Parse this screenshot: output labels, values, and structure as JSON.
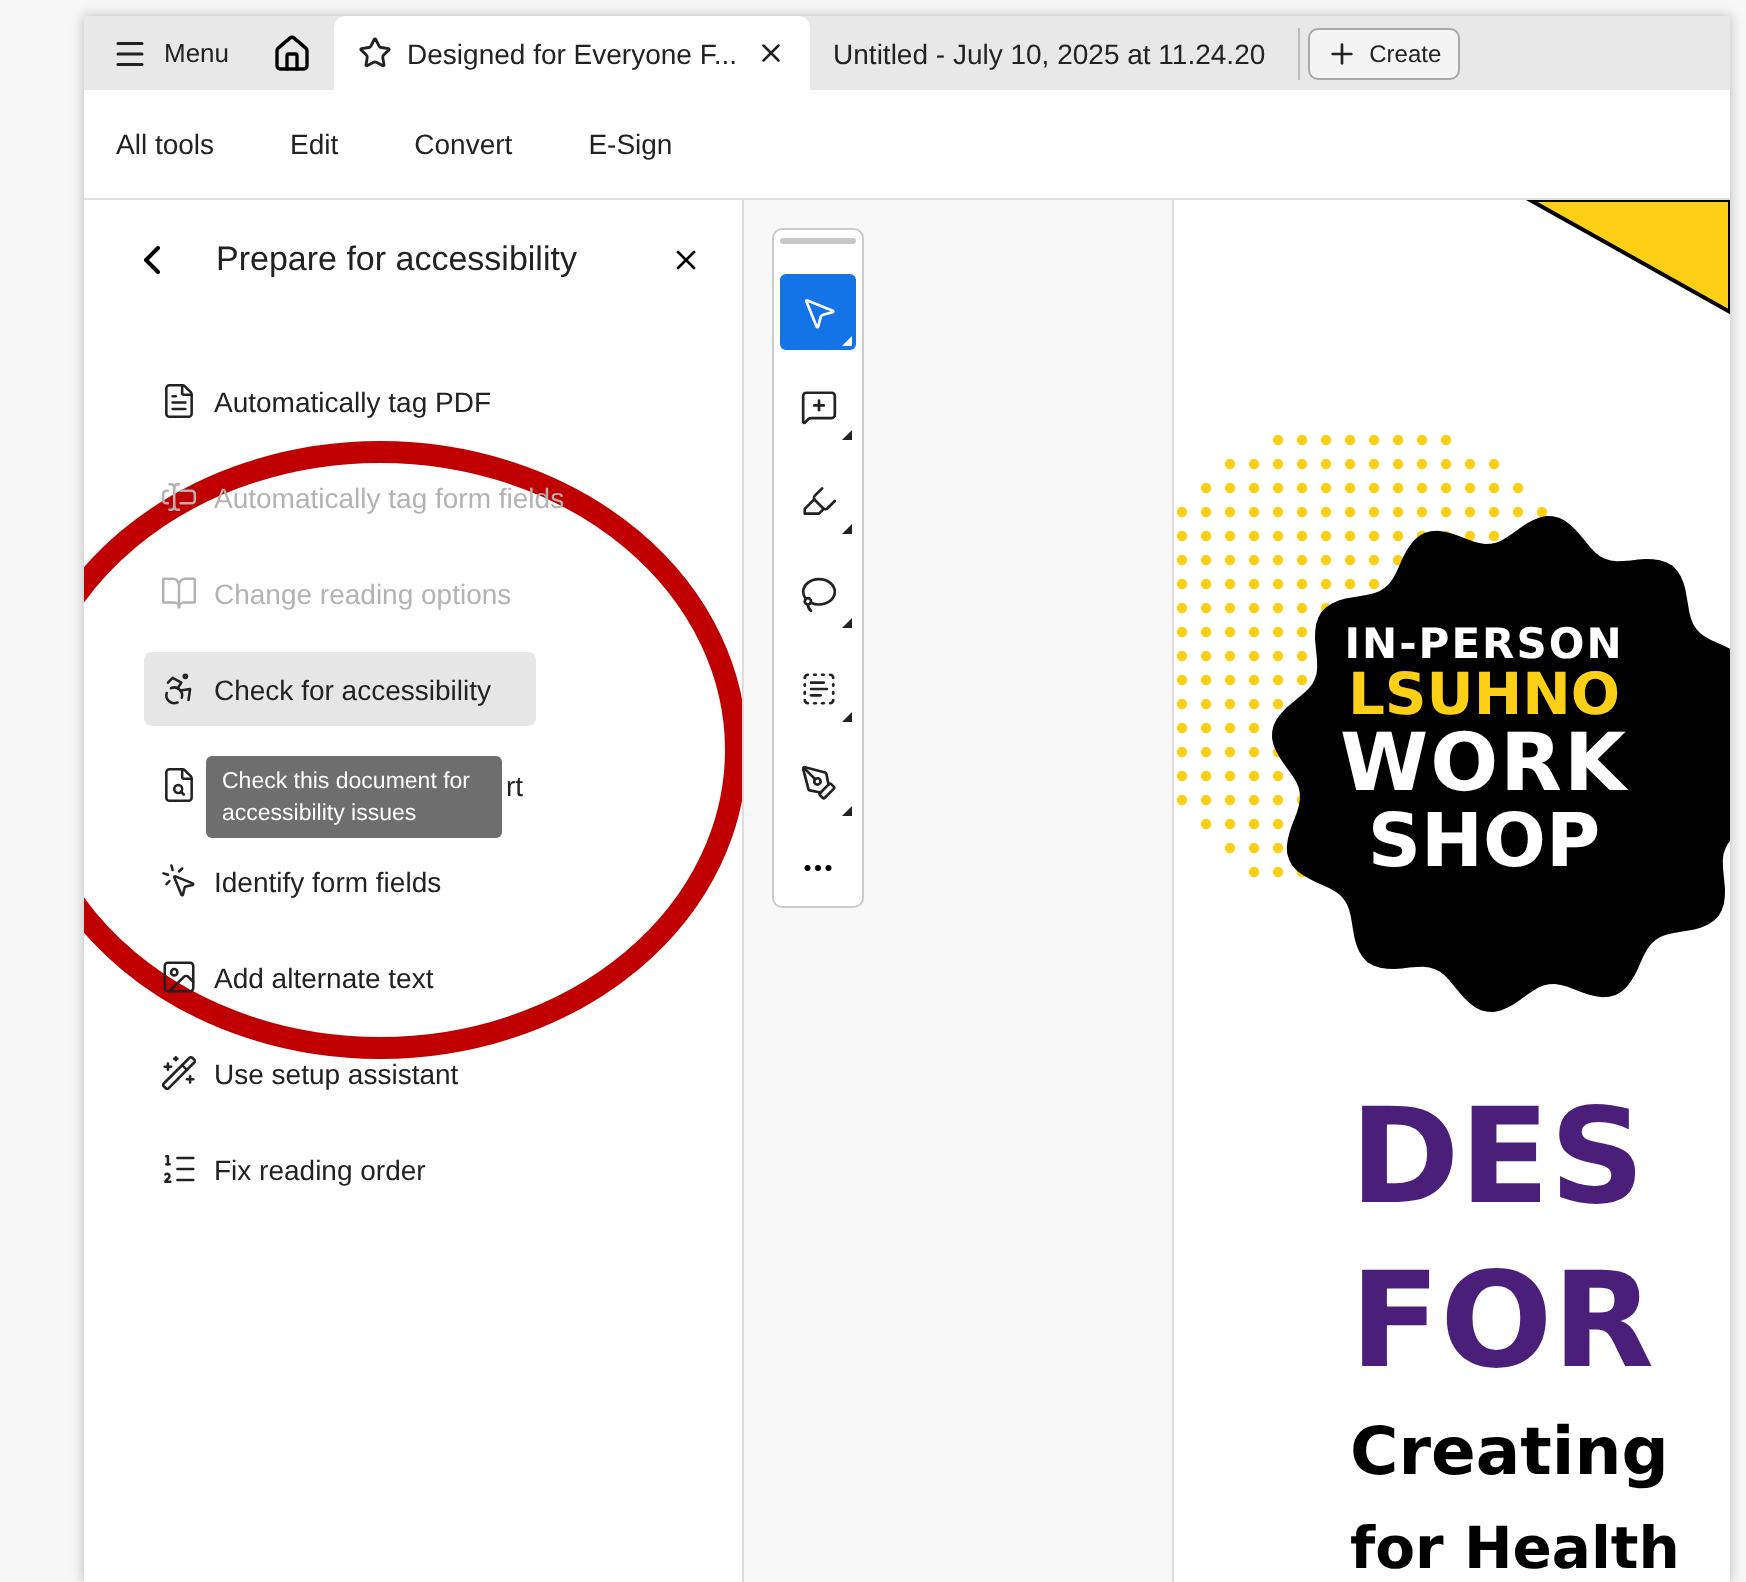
{
  "menu_label": "Menu",
  "tabs": [
    {
      "title": "Designed for Everyone F...",
      "selected": true
    },
    {
      "title": "Untitled - July 10, 2025 at 11.24.20",
      "selected": false
    }
  ],
  "create_label": "Create",
  "menu": [
    "All tools",
    "Edit",
    "Convert",
    "E-Sign"
  ],
  "panel": {
    "title": "Prepare for accessibility",
    "items": [
      {
        "label": "Automatically tag PDF",
        "disabled": false,
        "selected": false
      },
      {
        "label": "Automatically tag form fields",
        "disabled": true,
        "selected": false
      },
      {
        "label": "Change reading options",
        "disabled": true,
        "selected": false
      },
      {
        "label": "Check for accessibility",
        "disabled": false,
        "selected": true
      },
      {
        "label": "rt",
        "disabled": false,
        "selected": false
      },
      {
        "label": "Identify form fields",
        "disabled": false,
        "selected": false
      },
      {
        "label": "Add alternate text",
        "disabled": false,
        "selected": false
      },
      {
        "label": "Use setup assistant",
        "disabled": false,
        "selected": false
      },
      {
        "label": "Fix reading order",
        "disabled": false,
        "selected": false
      }
    ]
  },
  "tooltip": "Check this document for accessibility issues",
  "tools": [
    {
      "selected": true
    },
    {
      "selected": false
    },
    {
      "selected": false
    },
    {
      "selected": false
    },
    {
      "selected": false
    },
    {
      "selected": false
    }
  ],
  "document": {
    "badge_lines": [
      {
        "text": "IN-PERSON",
        "color": "#ffffff"
      },
      {
        "text": "LSUHNO",
        "color": "#fdd017"
      },
      {
        "text": "WORK",
        "color": "#ffffff"
      },
      {
        "text": "SHOP",
        "color": "#ffffff"
      }
    ],
    "title_lines": [
      "DES",
      "FOR"
    ],
    "subtitle_lines": [
      "Creating",
      "for Health"
    ]
  }
}
